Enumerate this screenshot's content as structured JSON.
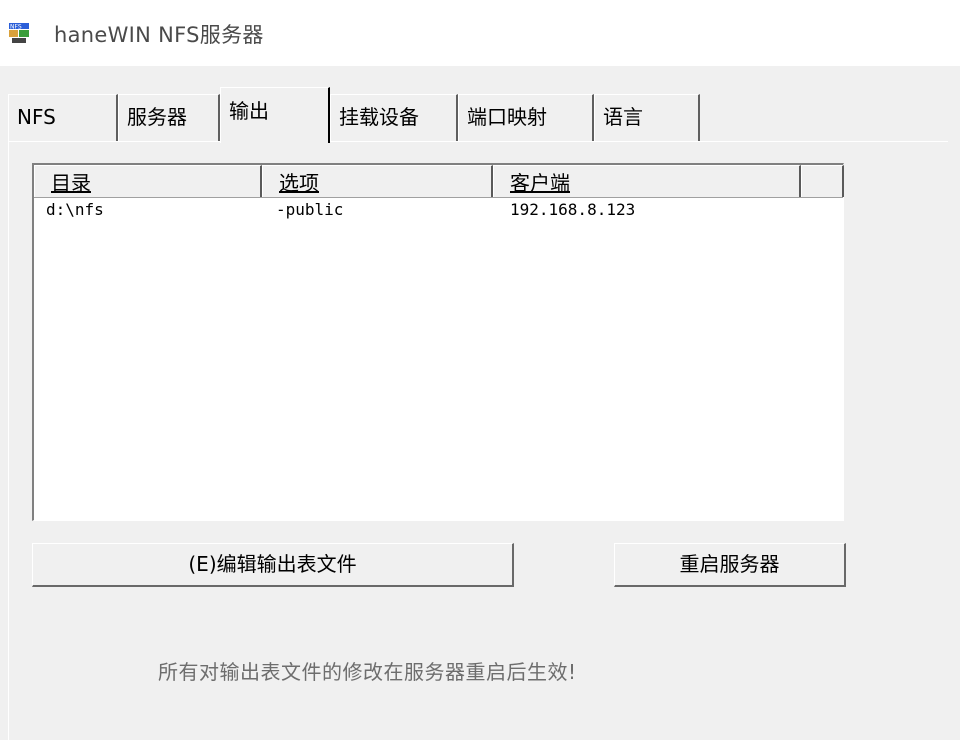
{
  "window": {
    "title": "haneWIN NFS服务器",
    "icon": "nfs-app-icon"
  },
  "tabs": [
    {
      "label": "NFS",
      "active": false
    },
    {
      "label": "服务器",
      "active": false
    },
    {
      "label": "输出",
      "active": true
    },
    {
      "label": "挂载设备",
      "active": false
    },
    {
      "label": "端口映射",
      "active": false
    },
    {
      "label": "语言",
      "active": false
    }
  ],
  "exports_list": {
    "columns": [
      "目录",
      "选项",
      "客户端",
      ""
    ],
    "rows": [
      {
        "directory": "d:\\nfs",
        "options": "-public",
        "clients": "192.168.8.123"
      }
    ]
  },
  "buttons": {
    "edit_exports": "(E)编辑输出表文件",
    "restart_server": "重启服务器"
  },
  "notice": "所有对输出表文件的修改在服务器重启后生效!"
}
